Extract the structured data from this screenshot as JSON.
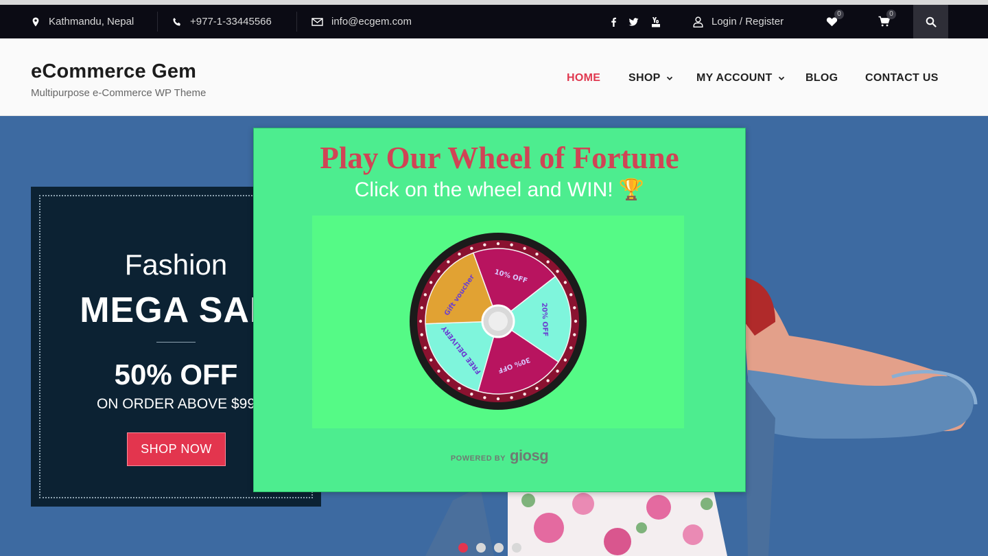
{
  "topbar": {
    "location": "Kathmandu, Nepal",
    "phone": "+977-1-33445566",
    "email": "info@ecgem.com",
    "login": "Login / Register",
    "wishlist_count": "0",
    "cart_count": "0",
    "social": [
      "facebook-icon",
      "twitter-icon",
      "youtube-icon"
    ]
  },
  "header": {
    "site_title": "eCommerce Gem",
    "tagline": "Multipurpose e-Commerce WP Theme",
    "nav": [
      {
        "label": "HOME",
        "active": true
      },
      {
        "label": "SHOP",
        "dropdown": true
      },
      {
        "label": "MY ACCOUNT",
        "dropdown": true
      },
      {
        "label": "BLOG"
      },
      {
        "label": "CONTACT US"
      }
    ]
  },
  "hero": {
    "line1": "Fashion",
    "line2": "MEGA SAL",
    "line3": "50% OFF",
    "line4": "ON ORDER ABOVE $99",
    "button": "SHOP NOW",
    "slides": 4,
    "active_slide": 1
  },
  "popup": {
    "title": "Play Our Wheel of Fortune",
    "subtitle": "Click on the wheel and WIN! 🏆",
    "wheel_segments": [
      "10% OFF",
      "20% OFF",
      "30% OFF",
      "FREE DELIVERY",
      "Gift voucher"
    ],
    "powered_label": "POWERED BY",
    "powered_brand": "giosg"
  },
  "colors": {
    "accent": "#e3354e",
    "topbar": "#0b0b14",
    "popup_bg": "#4ded8f",
    "hero_bg": "#3d6aa1"
  }
}
